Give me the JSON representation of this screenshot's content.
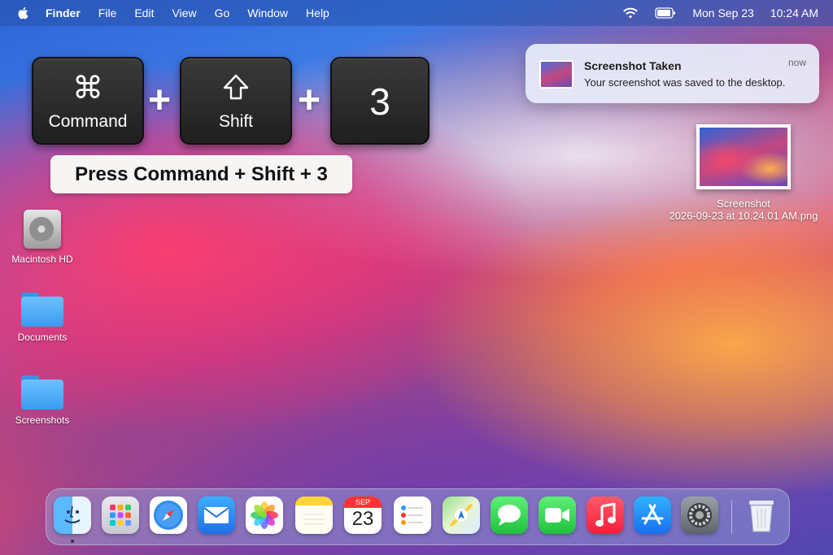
{
  "menubar": {
    "app_name": "Finder",
    "menus": [
      "File",
      "Edit",
      "View",
      "Go",
      "Window",
      "Help"
    ],
    "date": "Mon Sep 23",
    "time": "10:24 AM"
  },
  "keys": {
    "command_symbol": "⌘",
    "command_label": "Command",
    "shift_label": "Shift",
    "three_label": "3",
    "plus": "+"
  },
  "instruction": "Press Command + Shift + 3",
  "notification": {
    "title": "Screenshot Taken",
    "body": "Your screenshot was saved to the desktop.",
    "time": "now"
  },
  "desktop": {
    "macintosh_hd": "Macintosh HD",
    "documents": "Documents",
    "screenshots": "Screenshots",
    "screenshot_file_line1": "Screenshot",
    "screenshot_file_line2": "2026-09-23 at 10.24.01 AM.png"
  },
  "dock": {
    "calendar_month": "SEP",
    "calendar_day": "23"
  }
}
